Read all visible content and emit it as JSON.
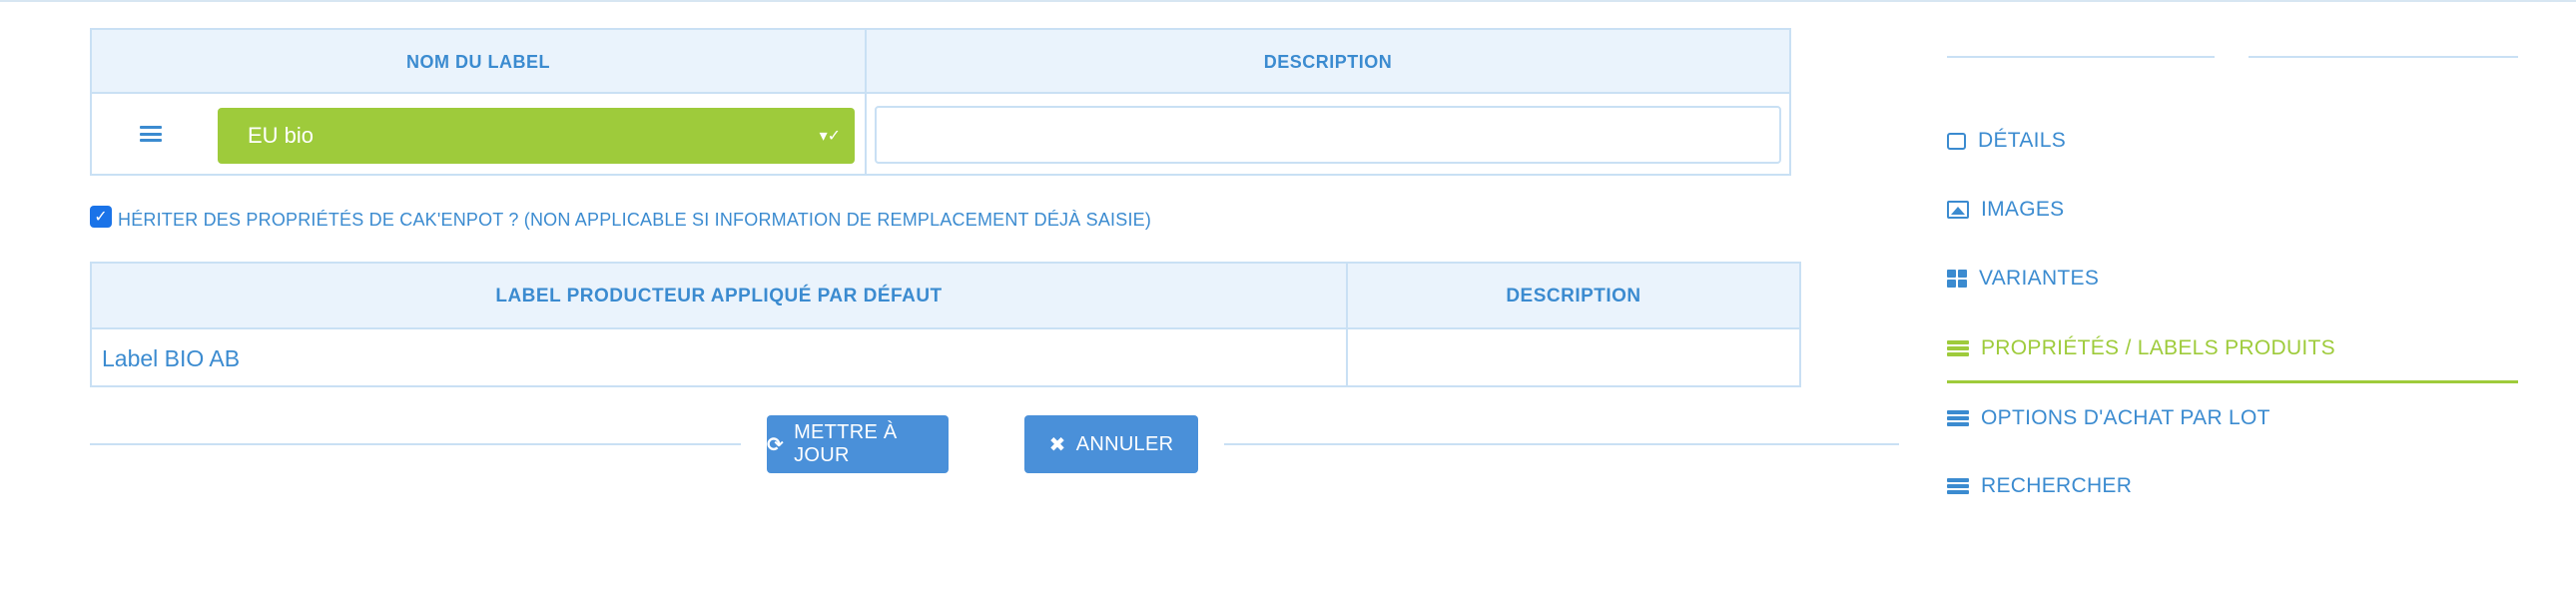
{
  "labels_table": {
    "col_name": "NOM DU LABEL",
    "col_description": "DESCRIPTION",
    "row": {
      "label_value": "EU bio",
      "description_value": ""
    }
  },
  "inherit_checkbox": {
    "checked": true,
    "label": "HÉRITER DES PROPRIÉTÉS DE CAK'ENPOT ? (NON APPLICABLE SI INFORMATION DE REMPLACEMENT DÉJÀ SAISIE)"
  },
  "producer_table": {
    "col_label": "LABEL PRODUCTEUR APPLIQUÉ PAR DÉFAUT",
    "col_description": "DESCRIPTION",
    "rows": [
      {
        "label": "Label BIO AB",
        "description": ""
      }
    ]
  },
  "actions": {
    "update_label": "METTRE À JOUR",
    "cancel_label": "ANNULER"
  },
  "side_menu": {
    "items": [
      {
        "label": "DÉTAILS",
        "icon": "edit-icon"
      },
      {
        "label": "IMAGES",
        "icon": "image-icon"
      },
      {
        "label": "VARIANTES",
        "icon": "grid-icon"
      },
      {
        "label": "PROPRIÉTÉS / LABELS PRODUITS",
        "icon": "table-icon",
        "active": true
      },
      {
        "label": "OPTIONS D'ACHAT PAR LOT",
        "icon": "table-icon"
      },
      {
        "label": "RECHERCHER",
        "icon": "table-icon"
      }
    ]
  },
  "colors": {
    "accent_blue": "#3b8bd0",
    "active_green": "#9ecb3b",
    "button_blue": "#4a90d9",
    "header_bg": "#eaf3fc"
  }
}
